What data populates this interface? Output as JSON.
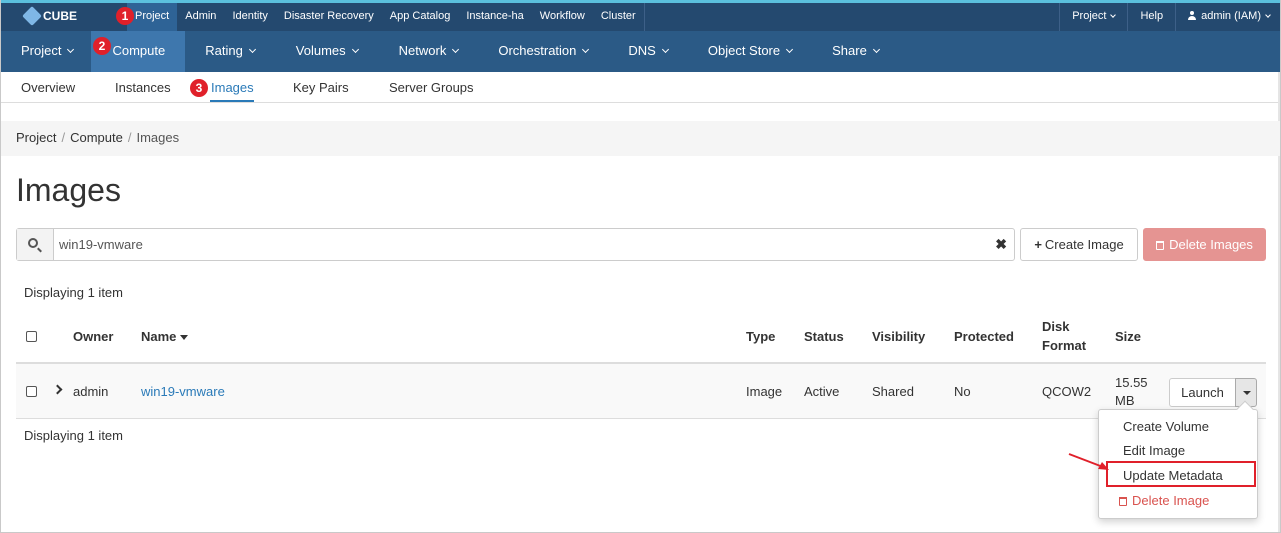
{
  "brand": {
    "name": "CUBE"
  },
  "top_nav": {
    "items": [
      "Project",
      "Admin",
      "Identity",
      "Disaster Recovery",
      "App Catalog",
      "Instance-ha",
      "Workflow",
      "Cluster"
    ],
    "right": {
      "project_menu": "Project",
      "help": "Help",
      "user": "admin (IAM)"
    }
  },
  "second_nav": {
    "items": [
      "Project",
      "Compute",
      "Rating",
      "Volumes",
      "Network",
      "Orchestration",
      "DNS",
      "Object Store",
      "Share"
    ]
  },
  "third_nav": {
    "items": [
      "Overview",
      "Instances",
      "Images",
      "Key Pairs",
      "Server Groups"
    ]
  },
  "annotations": {
    "badges": [
      "1",
      "2",
      "3"
    ]
  },
  "breadcrumb": [
    "Project",
    "Compute",
    "Images"
  ],
  "page_title": "Images",
  "search": {
    "value": "win19-vmware"
  },
  "actions": {
    "create": "Create Image",
    "delete": "Delete Images"
  },
  "display_count": "Displaying 1 item",
  "table": {
    "headers": {
      "owner": "Owner",
      "name": "Name",
      "type": "Type",
      "status": "Status",
      "visibility": "Visibility",
      "protected": "Protected",
      "disk_format_1": "Disk",
      "disk_format_2": "Format",
      "size": "Size"
    },
    "rows": [
      {
        "owner": "admin",
        "name": "win19-vmware",
        "type": "Image",
        "status": "Active",
        "visibility": "Shared",
        "protected": "No",
        "disk_format": "QCOW2",
        "size_1": "15.55",
        "size_2": "MB"
      }
    ]
  },
  "row_actions": {
    "launch": "Launch",
    "menu": [
      "Create Volume",
      "Edit Image",
      "Update Metadata",
      "Delete Image"
    ]
  },
  "colors": {
    "top_bar": "#24496f",
    "second_bar": "#2b5a86",
    "active": "#3e77ad",
    "link": "#2a7ab8",
    "danger": "#d9534f",
    "highlight": "#e0202a"
  }
}
